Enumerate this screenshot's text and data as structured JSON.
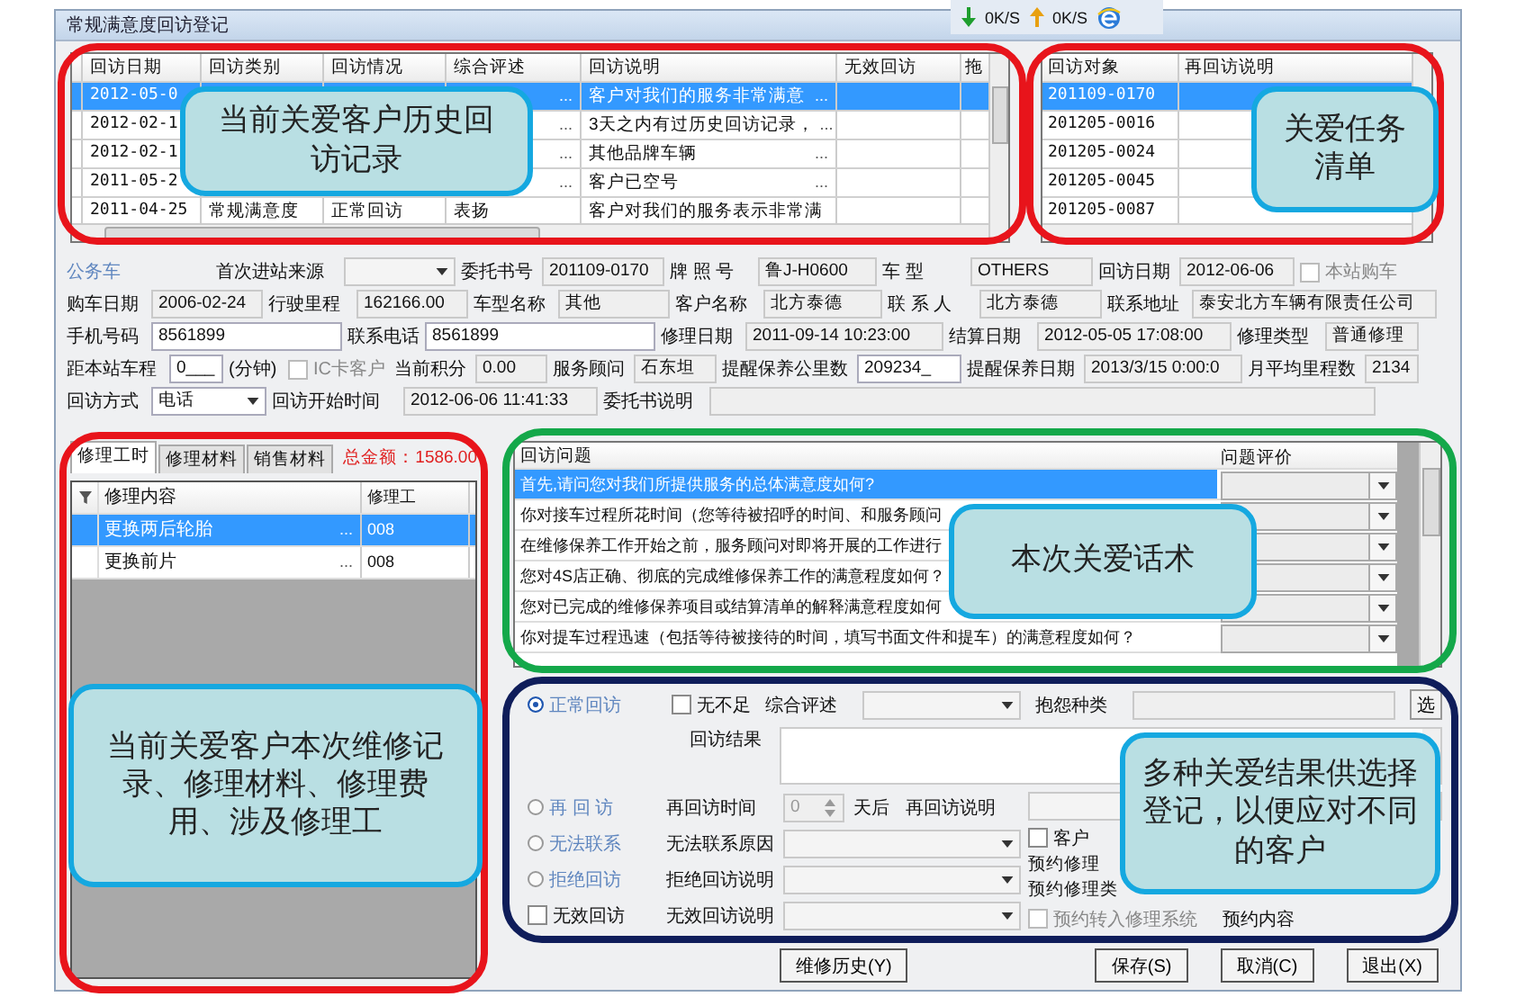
{
  "window": {
    "title": "常规满意度回访登记"
  },
  "net_speed": {
    "down": "0K/S",
    "up": "0K/S"
  },
  "history_table": {
    "columns": [
      "回访日期",
      "回访类别",
      "回访情况",
      "综合评述",
      "回访说明",
      "无效回访",
      "拖"
    ],
    "rows": [
      {
        "date": "2012-05-0",
        "rating_more": "...",
        "note": "客户对我们的服务非常满意",
        "note_more": "...",
        "selected": true
      },
      {
        "date": "2012-02-1",
        "rating_more": "...",
        "note": "3天之内有过历史回访记录，",
        "note_more": "...",
        "selected": false
      },
      {
        "date": "2012-02-1",
        "rating_more": "...",
        "note": "其他品牌车辆",
        "note_more": "...",
        "selected": false
      },
      {
        "date": "2011-05-2",
        "rating_more": "...",
        "note": "客户已空号",
        "note_more": "...",
        "selected": false
      },
      {
        "date": "2011-04-25",
        "category": "常规满意度",
        "status": "正常回访",
        "rating": "表扬",
        "note": "客户对我们的服务表示非常满",
        "selected": false
      }
    ]
  },
  "task_table": {
    "columns": [
      "回访对象",
      "再回访说明"
    ],
    "rows": [
      {
        "target": "201109-0170",
        "selected": true
      },
      {
        "target": "201205-0016",
        "selected": false
      },
      {
        "target": "201205-0024",
        "selected": false
      },
      {
        "target": "201205-0045",
        "selected": false
      },
      {
        "target": "201205-0087",
        "selected": false
      }
    ]
  },
  "form": {
    "rows": [
      {
        "items": [
          {
            "kind": "caption",
            "text": "公务车"
          },
          {
            "kind": "label",
            "text": "首次进站来源"
          },
          {
            "kind": "combo"
          },
          {
            "kind": "label",
            "text": "委托书号"
          },
          {
            "kind": "field",
            "value": "201109-0170"
          },
          {
            "kind": "label",
            "text": "牌 照 号"
          },
          {
            "kind": "field",
            "value": "鲁J-H0600"
          },
          {
            "kind": "label",
            "text": "车    型"
          },
          {
            "kind": "field",
            "value": "OTHERS"
          },
          {
            "kind": "label",
            "text": "回访日期"
          },
          {
            "kind": "field",
            "value": "2012-06-06"
          },
          {
            "kind": "checkbox",
            "text": "本站购车",
            "checked": false,
            "disabled": true
          }
        ]
      },
      {
        "items": [
          {
            "kind": "label",
            "text": "购车日期"
          },
          {
            "kind": "field",
            "value": "2006-02-24"
          },
          {
            "kind": "label",
            "text": "行驶里程"
          },
          {
            "kind": "field",
            "value": "162166.00"
          },
          {
            "kind": "label",
            "text": "车型名称"
          },
          {
            "kind": "field",
            "value": "其他"
          },
          {
            "kind": "label",
            "text": "客户名称"
          },
          {
            "kind": "field",
            "value": "北方泰德"
          },
          {
            "kind": "label",
            "text": "联 系 人"
          },
          {
            "kind": "field",
            "value": "北方泰德"
          },
          {
            "kind": "label",
            "text": "联系地址"
          },
          {
            "kind": "field",
            "value": "泰安北方车辆有限责任公司"
          }
        ]
      },
      {
        "items": [
          {
            "kind": "label",
            "text": "手机号码"
          },
          {
            "kind": "input",
            "value": "8561899"
          },
          {
            "kind": "label",
            "text": "联系电话"
          },
          {
            "kind": "input",
            "value": "8561899"
          },
          {
            "kind": "label",
            "text": "修理日期"
          },
          {
            "kind": "field",
            "value": "2011-09-14 10:23:00"
          },
          {
            "kind": "label",
            "text": "结算日期"
          },
          {
            "kind": "field",
            "value": "2012-05-05 17:08:00"
          },
          {
            "kind": "label",
            "text": "修理类型"
          },
          {
            "kind": "field",
            "value": "普通修理"
          }
        ]
      },
      {
        "items": [
          {
            "kind": "label",
            "text": "距本站车程"
          },
          {
            "kind": "input",
            "value": "0___"
          },
          {
            "kind": "label",
            "text": "(分钟)"
          },
          {
            "kind": "checkbox",
            "text": "IC卡客户",
            "checked": false,
            "disabled": true
          },
          {
            "kind": "label",
            "text": "当前积分"
          },
          {
            "kind": "field",
            "value": "0.00"
          },
          {
            "kind": "label",
            "text": "服务顾问"
          },
          {
            "kind": "field",
            "value": "石东坦"
          },
          {
            "kind": "label",
            "text": "提醒保养公里数"
          },
          {
            "kind": "input",
            "value": "209234_"
          },
          {
            "kind": "label",
            "text": "提醒保养日期"
          },
          {
            "kind": "field",
            "value": "2013/3/15 0:00:0"
          },
          {
            "kind": "label",
            "text": "月平均里程数"
          },
          {
            "kind": "field",
            "value": "2134"
          }
        ]
      },
      {
        "items": [
          {
            "kind": "label",
            "text": "回访方式"
          },
          {
            "kind": "combo",
            "value": "电话"
          },
          {
            "kind": "label",
            "text": "回访开始时间"
          },
          {
            "kind": "field",
            "value": "2012-06-06 11:41:33"
          },
          {
            "kind": "label",
            "text": "委托书说明"
          },
          {
            "kind": "field"
          }
        ]
      }
    ]
  },
  "repair_panel": {
    "tabs": [
      {
        "label": "修理工时",
        "selected": true
      },
      {
        "label": "修理材料",
        "selected": false
      },
      {
        "label": "销售材料",
        "selected": false
      }
    ],
    "total": "总金额：1586.00",
    "columns": [
      "修理内容",
      "修理工"
    ],
    "rows": [
      {
        "content": "更换两后轮胎",
        "more": "...",
        "worker": "008",
        "selected": true
      },
      {
        "content": "更换前片",
        "more": "...",
        "worker": "008",
        "selected": false
      }
    ]
  },
  "questions": {
    "columns": [
      "回访问题",
      "问题评价"
    ],
    "rows": [
      {
        "text": "首先,请问您对我们所提供服务的总体满意度如何?",
        "selected": true
      },
      {
        "text": "你对接车过程所花时间（您等待被招呼的时间、和服务顾问",
        "selected": false
      },
      {
        "text": "在维修保养工作开始之前，服务顾问对即将开展的工作进行",
        "selected": false
      },
      {
        "text": "您对4S店正确、彻底的完成维修保养工作的满意程度如何？",
        "selected": false
      },
      {
        "text": "您对已完成的维修保养项目或结算清单的解释满意程度如何",
        "selected": false
      },
      {
        "text": "你对提车过程迅速（包括等待被接待的时间，填写书面文件和提车）的满意程度如何？",
        "selected": false
      }
    ]
  },
  "result_form": {
    "modes": [
      {
        "label": "正常回访",
        "selected": true
      },
      {
        "label": "再 回 访",
        "selected": false
      },
      {
        "label": "无法联系",
        "selected": false
      },
      {
        "label": "拒绝回访",
        "selected": false
      }
    ],
    "no_shortfall": {
      "label": "无不足",
      "checked": false
    },
    "rating_label": "综合评述",
    "complaint_label": "抱怨种类",
    "select_button": "选",
    "result_label": "回访结果",
    "revisit_time_label": "再回访时间",
    "revisit_days": "0",
    "days_after": "天后",
    "revisit_note_label": "再回访说明",
    "unreachable_label": "无法联系原因",
    "customer_check": {
      "label": "客户",
      "checked": false
    },
    "booking_label": "预约修理",
    "booking_type_label": "预约修理类",
    "refuse_label": "拒绝回访说明",
    "invalid": {
      "label": "无效回访",
      "checked": false
    },
    "invalid_label": "无效回访说明",
    "transfer_check": {
      "label": "预约转入修理系统",
      "checked": false,
      "disabled": true
    },
    "booking_content_label": "预约内容"
  },
  "buttons": [
    "维修历史(Y)",
    "保存(S)",
    "取消(C)",
    "退出(X)"
  ],
  "frames": [
    {
      "color": "#e8141b"
    },
    {
      "color": "#e8141b"
    },
    {
      "color": "#14a84a"
    },
    {
      "color": "#0f1d5a"
    },
    {
      "color": "#e8141b"
    }
  ],
  "callouts": [
    {
      "text": "当前关爱客户历史回访记录"
    },
    {
      "text": "关爱任务清单"
    },
    {
      "text": "本次关爱话术"
    },
    {
      "text": "当前关爱客户本次维修记录、修理材料、修理费用、涉及修理工"
    },
    {
      "text": "多种关爱结果供选择登记，以便应对不同的客户"
    }
  ]
}
